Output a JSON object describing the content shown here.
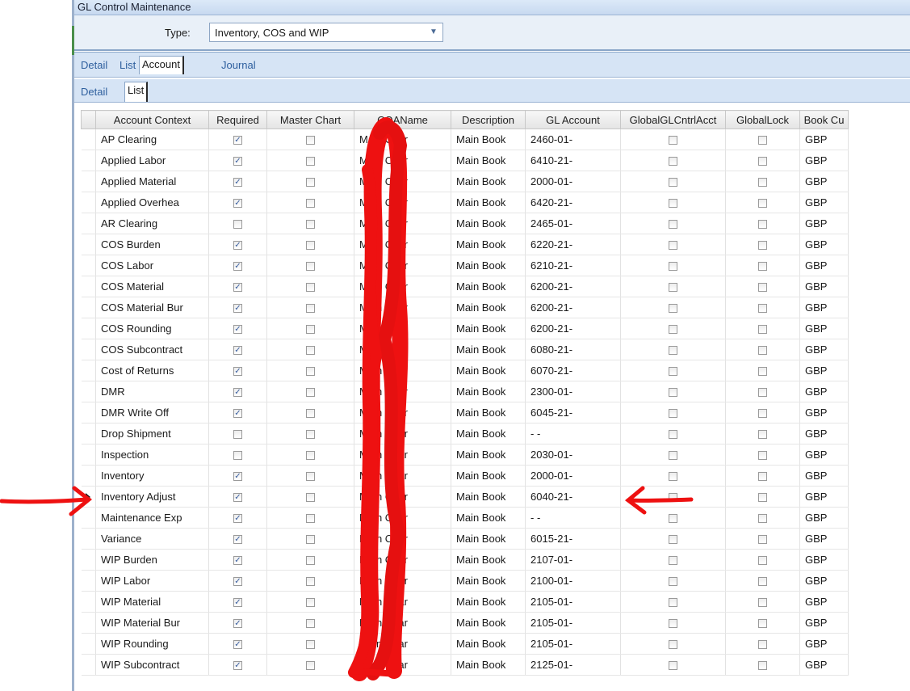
{
  "window": {
    "title": "GL Control Maintenance"
  },
  "type_field": {
    "label": "Type:",
    "value": "Inventory, COS and WIP"
  },
  "tabs_primary": [
    {
      "label": "Detail",
      "active": false
    },
    {
      "label": "List",
      "active": false
    },
    {
      "label": "Account",
      "active": true
    },
    {
      "label": "Journal",
      "active": false
    }
  ],
  "tabs_secondary": [
    {
      "label": "Detail",
      "active": false
    },
    {
      "label": "List",
      "active": true
    }
  ],
  "grid": {
    "columns": [
      "Account Context",
      "Required",
      "Master Chart",
      "COAName",
      "Description",
      "GL Account",
      "GlobalGLCntrlAcct",
      "GlobalLock",
      "Book Cu"
    ],
    "selected_row": 17,
    "rows": [
      {
        "context": "AP Clearing",
        "required": true,
        "coa": "Main Char",
        "description": "Main Book",
        "gl_account": "2460-01-",
        "currency": "GBP"
      },
      {
        "context": "Applied Labor",
        "required": true,
        "coa": "Main Char",
        "description": "Main Book",
        "gl_account": "6410-21-",
        "currency": "GBP"
      },
      {
        "context": "Applied Material",
        "required": true,
        "coa": "Main Char",
        "description": "Main Book",
        "gl_account": "2000-01-",
        "currency": "GBP"
      },
      {
        "context": "Applied Overhea",
        "required": true,
        "coa": "Main Char",
        "description": "Main Book",
        "gl_account": "6420-21-",
        "currency": "GBP"
      },
      {
        "context": "AR Clearing",
        "required": false,
        "coa": "Main Char",
        "description": "Main Book",
        "gl_account": "2465-01-",
        "currency": "GBP"
      },
      {
        "context": "COS Burden",
        "required": true,
        "coa": "Main Char",
        "description": "Main Book",
        "gl_account": "6220-21-",
        "currency": "GBP"
      },
      {
        "context": "COS Labor",
        "required": true,
        "coa": "Main Char",
        "description": "Main Book",
        "gl_account": "6210-21-",
        "currency": "GBP"
      },
      {
        "context": "COS Material",
        "required": true,
        "coa": "Main Char",
        "description": "Main Book",
        "gl_account": "6200-21-",
        "currency": "GBP"
      },
      {
        "context": "COS Material Bur",
        "required": true,
        "coa": "Main Char",
        "description": "Main Book",
        "gl_account": "6200-21-",
        "currency": "GBP"
      },
      {
        "context": "COS Rounding",
        "required": true,
        "coa": "Main Char",
        "description": "Main Book",
        "gl_account": "6200-21-",
        "currency": "GBP"
      },
      {
        "context": "COS Subcontract",
        "required": true,
        "coa": "Main Char",
        "description": "Main Book",
        "gl_account": "6080-21-",
        "currency": "GBP"
      },
      {
        "context": "Cost of Returns",
        "required": true,
        "coa": "Main Char",
        "description": "Main Book",
        "gl_account": "6070-21-",
        "currency": "GBP"
      },
      {
        "context": "DMR",
        "required": true,
        "coa": "Main Char",
        "description": "Main Book",
        "gl_account": "2300-01-",
        "currency": "GBP"
      },
      {
        "context": "DMR Write Off",
        "required": true,
        "coa": "Main Char",
        "description": "Main Book",
        "gl_account": "6045-21-",
        "currency": "GBP"
      },
      {
        "context": "Drop Shipment",
        "required": false,
        "coa": "Main Char",
        "description": "Main Book",
        "gl_account": "- -",
        "currency": "GBP"
      },
      {
        "context": "Inspection",
        "required": false,
        "coa": "Main Char",
        "description": "Main Book",
        "gl_account": "2030-01-",
        "currency": "GBP"
      },
      {
        "context": "Inventory",
        "required": true,
        "coa": "Main Char",
        "description": "Main Book",
        "gl_account": "2000-01-",
        "currency": "GBP"
      },
      {
        "context": "Inventory Adjust",
        "required": true,
        "coa": "Main Char",
        "description": "Main Book",
        "gl_account": "6040-21-",
        "currency": "GBP"
      },
      {
        "context": "Maintenance Exp",
        "required": true,
        "coa": "Main Char",
        "description": "Main Book",
        "gl_account": "- -",
        "currency": "GBP"
      },
      {
        "context": "Variance",
        "required": true,
        "coa": "Main Char",
        "description": "Main Book",
        "gl_account": "6015-21-",
        "currency": "GBP"
      },
      {
        "context": "WIP Burden",
        "required": true,
        "coa": "Main Char",
        "description": "Main Book",
        "gl_account": "2107-01-",
        "currency": "GBP"
      },
      {
        "context": "WIP Labor",
        "required": true,
        "coa": "Main Char",
        "description": "Main Book",
        "gl_account": "2100-01-",
        "currency": "GBP"
      },
      {
        "context": "WIP Material",
        "required": true,
        "coa": "Main Char",
        "description": "Main Book",
        "gl_account": "2105-01-",
        "currency": "GBP"
      },
      {
        "context": "WIP Material Bur",
        "required": true,
        "coa": "Main Char",
        "description": "Main Book",
        "gl_account": "2105-01-",
        "currency": "GBP"
      },
      {
        "context": "WIP Rounding",
        "required": true,
        "coa": "Main Char",
        "description": "Main Book",
        "gl_account": "2105-01-",
        "currency": "GBP"
      },
      {
        "context": "WIP Subcontract",
        "required": true,
        "coa": "Main Char",
        "description": "Main Book",
        "gl_account": "2125-01-",
        "currency": "GBP"
      }
    ]
  },
  "annotation_color": "#ee1111"
}
